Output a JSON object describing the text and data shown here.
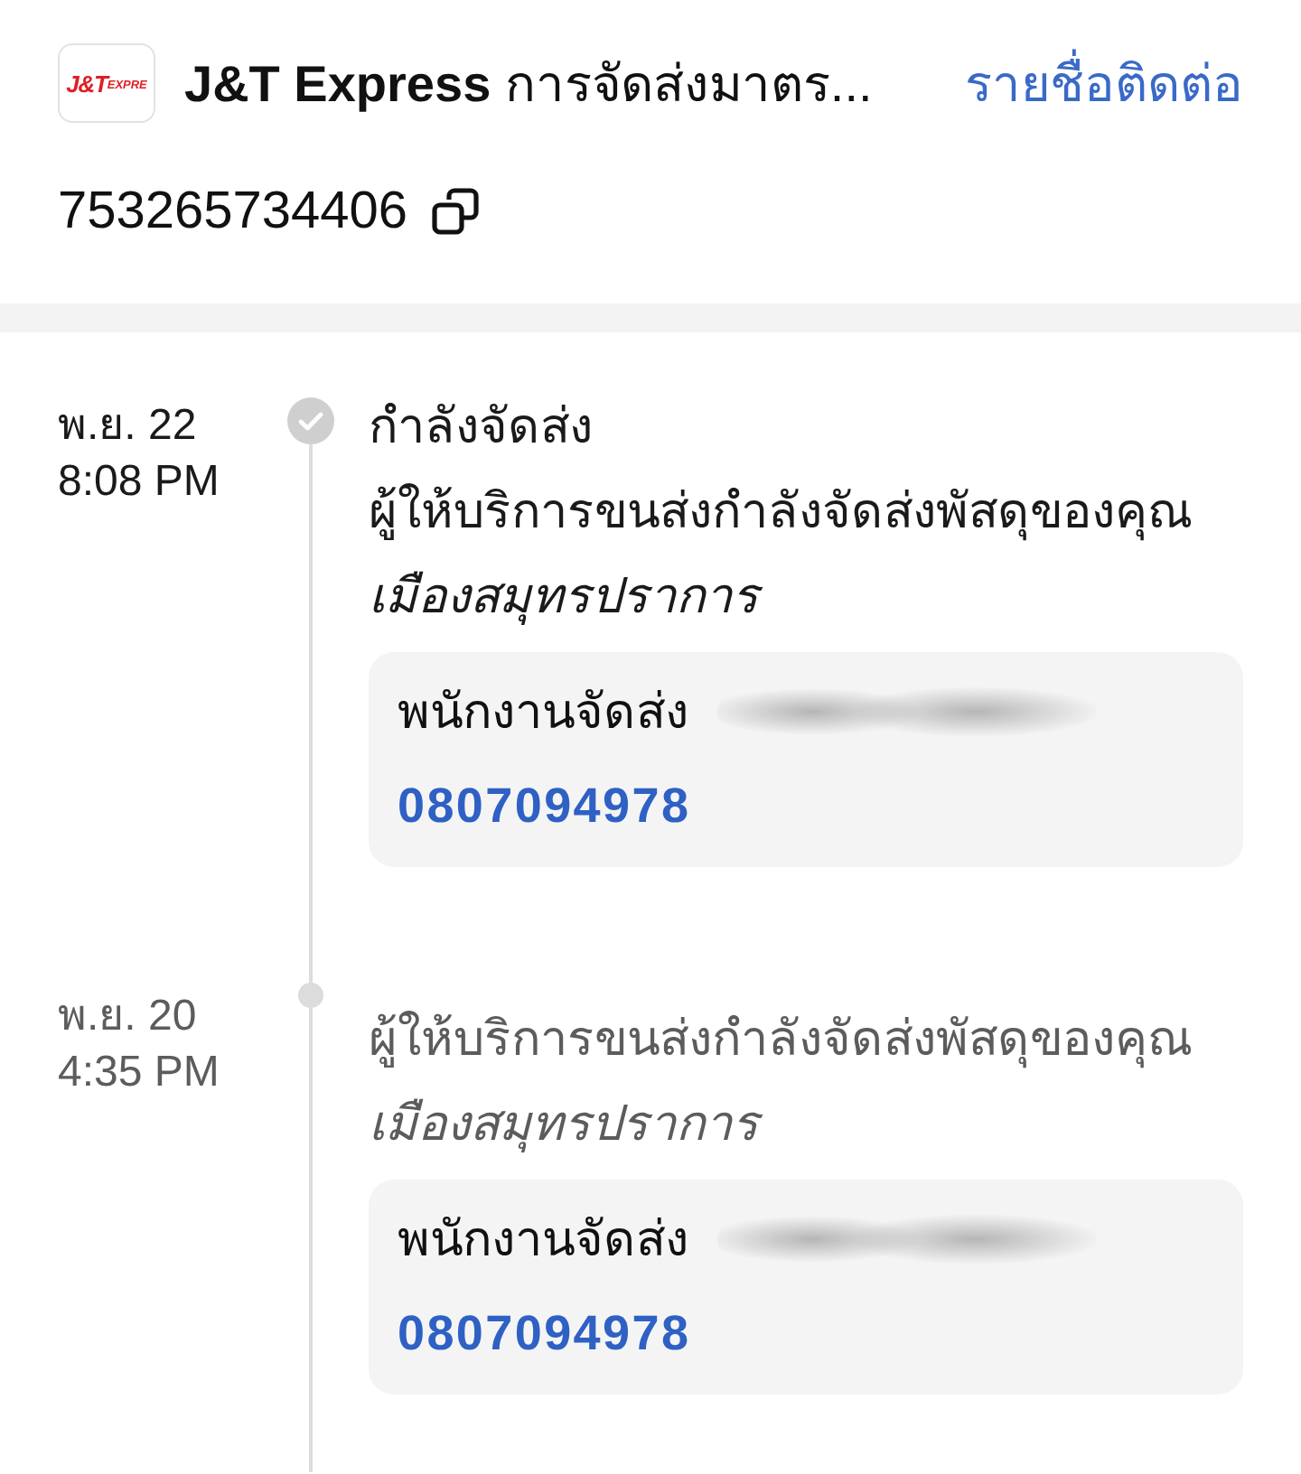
{
  "header": {
    "logo": {
      "mark": "J&T",
      "word": "EXPRE"
    },
    "title": "**J&T Express** การจัดส่งมาตร...",
    "contacts_link": "รายชื่อติดต่อ"
  },
  "tracking_number": "753265734406",
  "events": [
    {
      "date": "พ.ย. 22",
      "time": "8:08 PM",
      "current": true,
      "status": "กำลังจัดส่ง",
      "description": "ผู้ให้บริการขนส่งกำลังจัดส่งพัสดุของคุณ",
      "location": "เมืองสมุทรปราการ",
      "courier": {
        "label": "พนักงานจัดส่ง",
        "phone": "0807094978"
      }
    },
    {
      "date": "พ.ย. 20",
      "time": "4:35 PM",
      "current": false,
      "description": "ผู้ให้บริการขนส่งกำลังจัดส่งพัสดุของคุณ",
      "location": "เมืองสมุทรปราการ",
      "courier": {
        "label": "พนักงานจัดส่ง",
        "phone": "0807094978"
      }
    }
  ]
}
